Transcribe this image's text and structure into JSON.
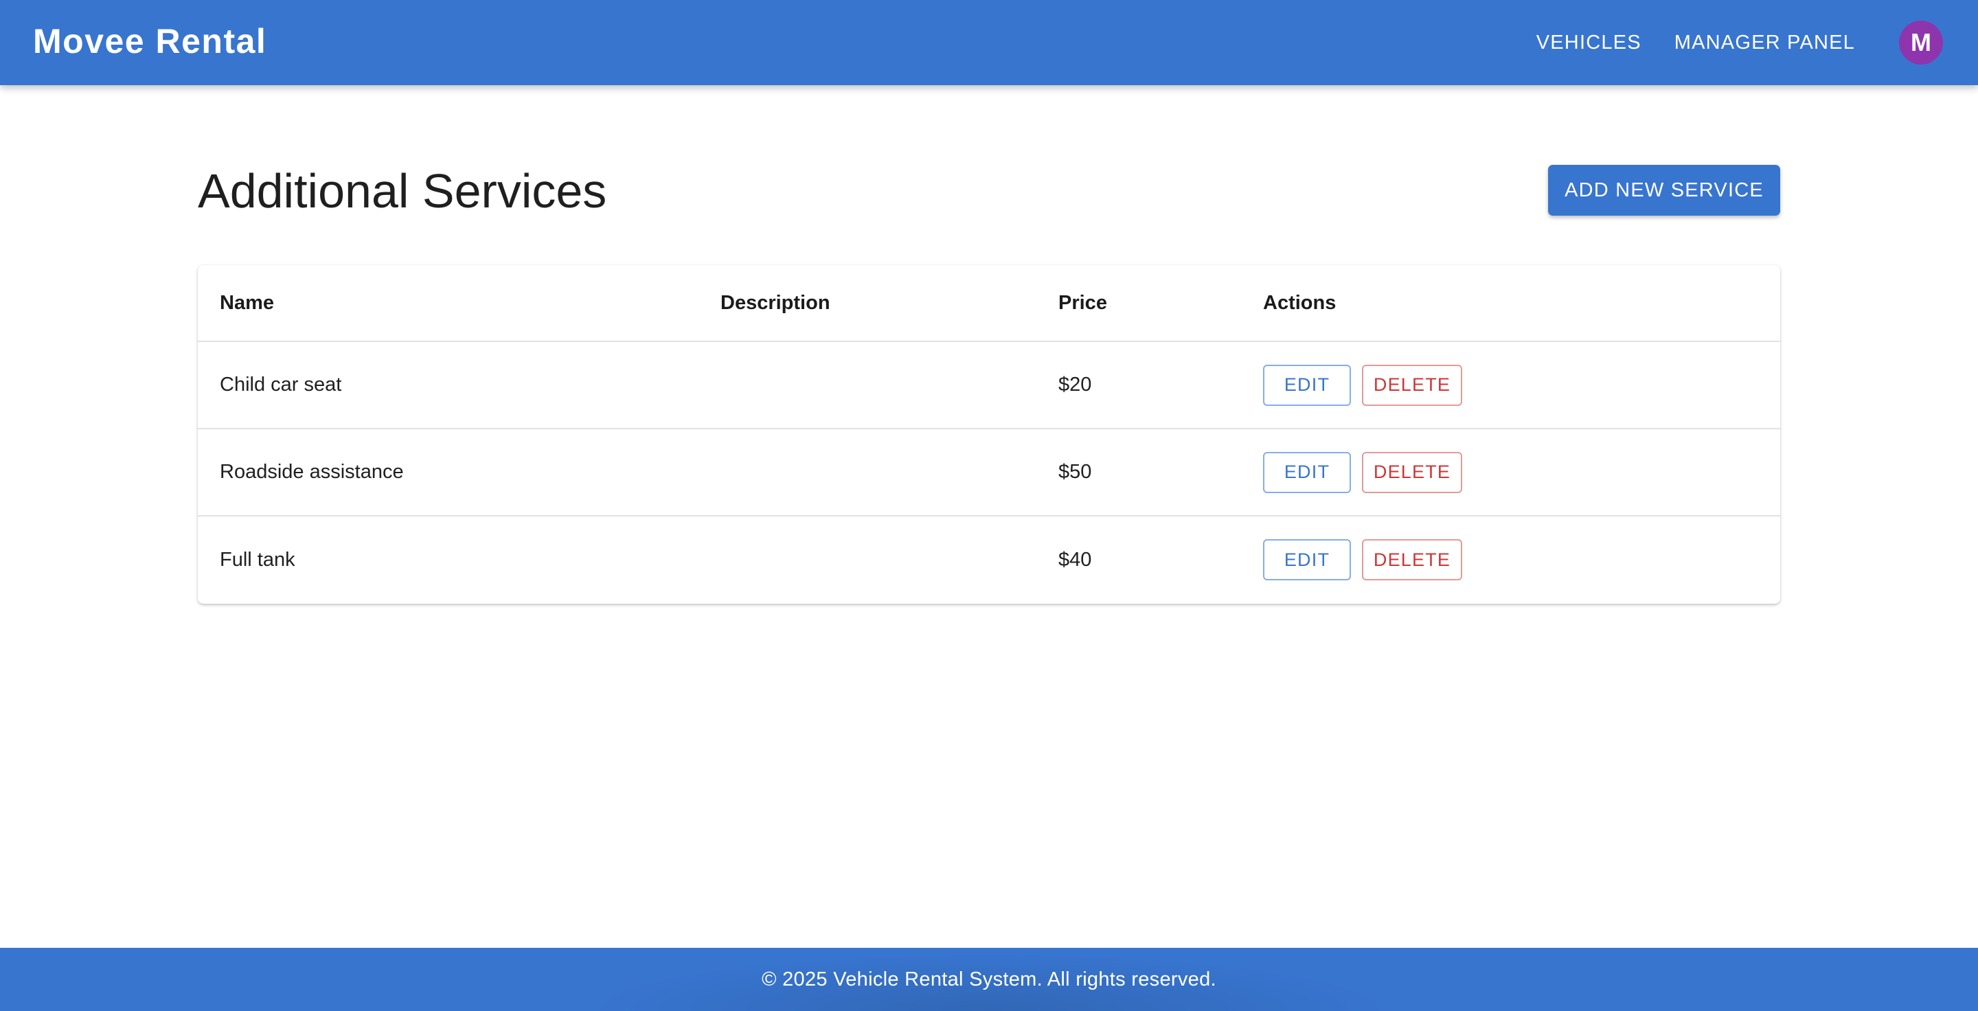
{
  "header": {
    "brand": "Movee Rental",
    "nav": [
      {
        "label": "VEHICLES"
      },
      {
        "label": "MANAGER PANEL"
      }
    ],
    "avatar_initial": "M"
  },
  "main": {
    "title": "Additional Services",
    "add_button_label": "ADD NEW SERVICE",
    "table": {
      "columns": [
        "Name",
        "Description",
        "Price",
        "Actions"
      ],
      "rows": [
        {
          "name": "Child car seat",
          "description": "",
          "price": "$20",
          "edit_label": "EDIT",
          "delete_label": "DELETE"
        },
        {
          "name": "Roadside assistance",
          "description": "",
          "price": "$50",
          "edit_label": "EDIT",
          "delete_label": "DELETE"
        },
        {
          "name": "Full tank",
          "description": "",
          "price": "$40",
          "edit_label": "EDIT",
          "delete_label": "DELETE"
        }
      ]
    }
  },
  "footer": {
    "text": "© 2025 Vehicle Rental System. All rights reserved."
  },
  "colors": {
    "primary": "#3875cf",
    "avatar": "#8e35ad",
    "danger": "#cf3535"
  }
}
